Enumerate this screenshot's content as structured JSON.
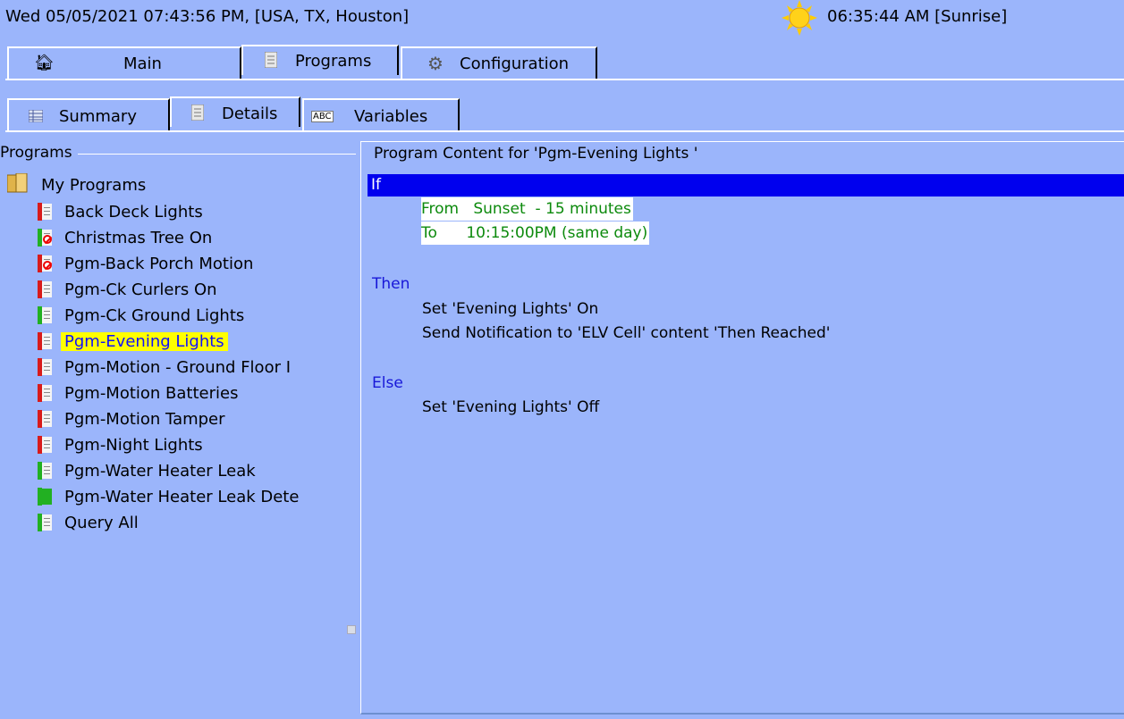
{
  "status_bar": {
    "datetime_location": "Wed 05/05/2021 07:43:56 PM,  [USA, TX, Houston]",
    "sunrise": "06:35:44 AM [Sunrise]"
  },
  "main_tabs": [
    {
      "label": "Main",
      "icon": "home-icon"
    },
    {
      "label": "Programs",
      "icon": "document-icon",
      "selected": true
    },
    {
      "label": "Configuration",
      "icon": "wrench-icon"
    }
  ],
  "sub_tabs": [
    {
      "label": "Summary",
      "icon": "table-icon"
    },
    {
      "label": "Details",
      "icon": "document-icon",
      "selected": true
    },
    {
      "label": "Variables",
      "icon": "abc-icon"
    }
  ],
  "programs_panel": {
    "title": "Programs",
    "root": "My Programs",
    "items": [
      {
        "label": "Back Deck Lights",
        "spine": "#d81b1b",
        "disabled": false
      },
      {
        "label": "Christmas Tree On",
        "spine": "#22b022",
        "disabled": true
      },
      {
        "label": "Pgm-Back Porch Motion",
        "spine": "#d81b1b",
        "disabled": true
      },
      {
        "label": "Pgm-Ck Curlers On",
        "spine": "#d81b1b",
        "disabled": false
      },
      {
        "label": "Pgm-Ck Ground Lights",
        "spine": "#22b022",
        "disabled": false
      },
      {
        "label": "Pgm-Evening Lights",
        "spine": "#d81b1b",
        "disabled": false,
        "selected": true
      },
      {
        "label": "Pgm-Motion - Ground Floor I",
        "spine": "#d81b1b",
        "disabled": false
      },
      {
        "label": "Pgm-Motion Batteries",
        "spine": "#d81b1b",
        "disabled": false
      },
      {
        "label": "Pgm-Motion Tamper",
        "spine": "#d81b1b",
        "disabled": false
      },
      {
        "label": "Pgm-Night Lights",
        "spine": "#d81b1b",
        "disabled": false
      },
      {
        "label": "Pgm-Water Heater Leak",
        "spine": "#22b022",
        "disabled": false
      },
      {
        "label": "Pgm-Water Heater Leak Dete",
        "spine": "#22b022",
        "disabled": false,
        "full_green": true
      },
      {
        "label": "Query All",
        "spine": "#22b022",
        "disabled": false
      }
    ]
  },
  "content_panel": {
    "title": "Program Content for 'Pgm-Evening Lights '",
    "if_label": "If",
    "conditions": [
      "From   Sunset  - 15 minutes",
      "To      10:15:00PM (same day)"
    ],
    "then_label": "Then",
    "then_actions": [
      "Set 'Evening Lights' On",
      "Send Notification to 'ELV Cell' content 'Then Reached'"
    ],
    "else_label": "Else",
    "else_actions": [
      "Set 'Evening Lights' Off"
    ]
  },
  "colors": {
    "background": "#9bb5fb",
    "if_bar": "#0000ee",
    "selection": "#ffff00",
    "condition_text": "#0c8a0c",
    "section_label": "#1818d8"
  }
}
